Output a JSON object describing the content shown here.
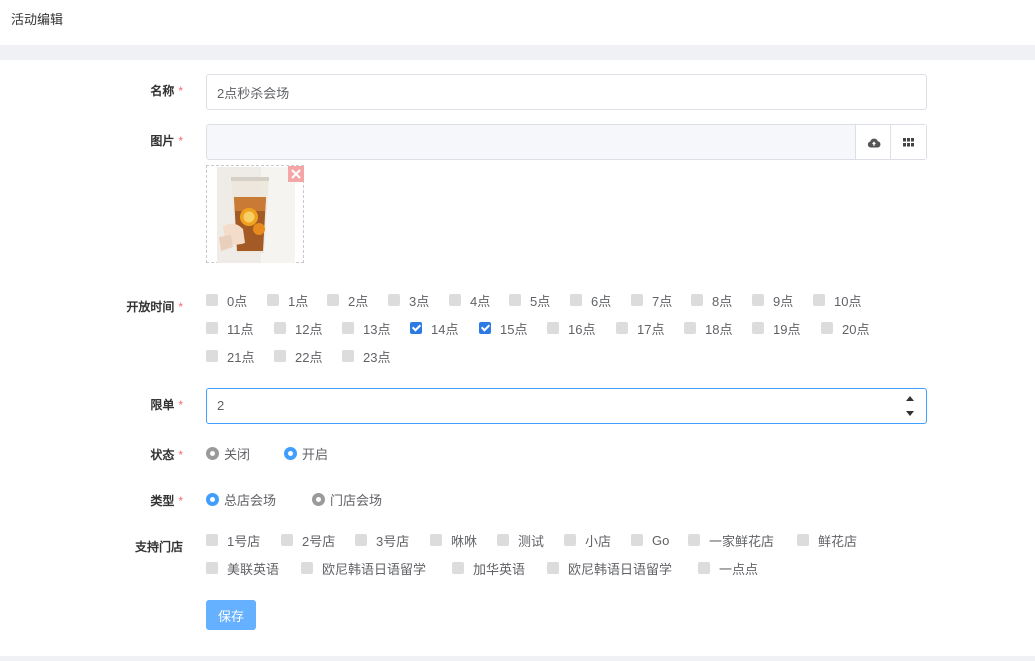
{
  "page": {
    "title": "活动编辑"
  },
  "form": {
    "name": {
      "label": "名称",
      "value": "2点秒杀会场"
    },
    "image": {
      "label": "图片"
    },
    "hours": {
      "label": "开放时间",
      "options": [
        {
          "label": "0点",
          "checked": false
        },
        {
          "label": "1点",
          "checked": false
        },
        {
          "label": "2点",
          "checked": false
        },
        {
          "label": "3点",
          "checked": false
        },
        {
          "label": "4点",
          "checked": false
        },
        {
          "label": "5点",
          "checked": false
        },
        {
          "label": "6点",
          "checked": false
        },
        {
          "label": "7点",
          "checked": false
        },
        {
          "label": "8点",
          "checked": false
        },
        {
          "label": "9点",
          "checked": false
        },
        {
          "label": "10点",
          "checked": false
        },
        {
          "label": "11点",
          "checked": false
        },
        {
          "label": "12点",
          "checked": false
        },
        {
          "label": "13点",
          "checked": false
        },
        {
          "label": "14点",
          "checked": true
        },
        {
          "label": "15点",
          "checked": true
        },
        {
          "label": "16点",
          "checked": false
        },
        {
          "label": "17点",
          "checked": false
        },
        {
          "label": "18点",
          "checked": false
        },
        {
          "label": "19点",
          "checked": false
        },
        {
          "label": "20点",
          "checked": false
        },
        {
          "label": "21点",
          "checked": false
        },
        {
          "label": "22点",
          "checked": false
        },
        {
          "label": "23点",
          "checked": false
        }
      ]
    },
    "limit": {
      "label": "限单",
      "value": "2"
    },
    "status": {
      "label": "状态",
      "options": [
        {
          "label": "关闭",
          "selected": false
        },
        {
          "label": "开启",
          "selected": true
        }
      ]
    },
    "type": {
      "label": "类型",
      "options": [
        {
          "label": "总店会场",
          "selected": true
        },
        {
          "label": "门店会场",
          "selected": false
        }
      ]
    },
    "stores": {
      "label": "支持门店",
      "options": [
        {
          "label": "1号店",
          "checked": false
        },
        {
          "label": "2号店",
          "checked": false
        },
        {
          "label": "3号店",
          "checked": false
        },
        {
          "label": "咻咻",
          "checked": false
        },
        {
          "label": "测试",
          "checked": false
        },
        {
          "label": "小店",
          "checked": false
        },
        {
          "label": "Go",
          "checked": false
        },
        {
          "label": "一家鲜花店",
          "checked": false
        },
        {
          "label": "鲜花店",
          "checked": false
        },
        {
          "label": "美联英语",
          "checked": false
        },
        {
          "label": "欧尼韩语日语留学",
          "checked": false
        },
        {
          "label": "加华英语",
          "checked": false
        },
        {
          "label": "欧尼韩语日语留学",
          "checked": false
        },
        {
          "label": "一点点",
          "checked": false
        }
      ]
    },
    "required_mark": "*",
    "save_label": "保存"
  },
  "colors": {
    "primary": "#409eff",
    "checked": "#2c7be5",
    "required": "#f56c6c",
    "save_button": "#66b1ff"
  }
}
